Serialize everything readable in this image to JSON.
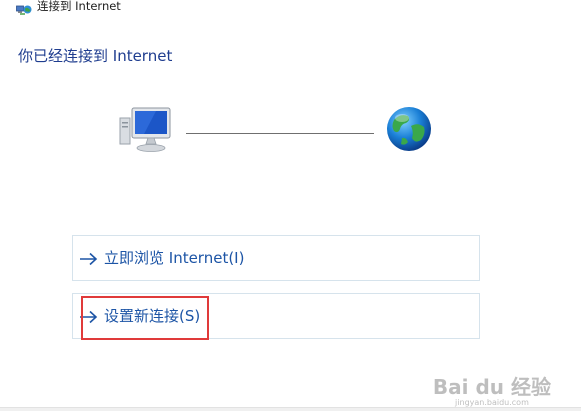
{
  "window": {
    "title": "连接到 Internet",
    "title_icon": "network-connect-icon"
  },
  "status": {
    "heading": "你已经连接到 Internet"
  },
  "diagram": {
    "left_icon": "computer-icon",
    "right_icon": "globe-icon"
  },
  "tasks": [
    {
      "label": "立即浏览 Internet(I)",
      "icon": "arrow-right-icon"
    },
    {
      "label": "设置新连接(S)",
      "icon": "arrow-right-icon"
    }
  ],
  "watermark": {
    "main": "Bai du 经验",
    "sub": "jingyan.baidu.com"
  },
  "colors": {
    "heading": "#1f3d8f",
    "link": "#1d55a6",
    "task_border": "#d6e3ec",
    "highlight": "#e03a3a"
  }
}
